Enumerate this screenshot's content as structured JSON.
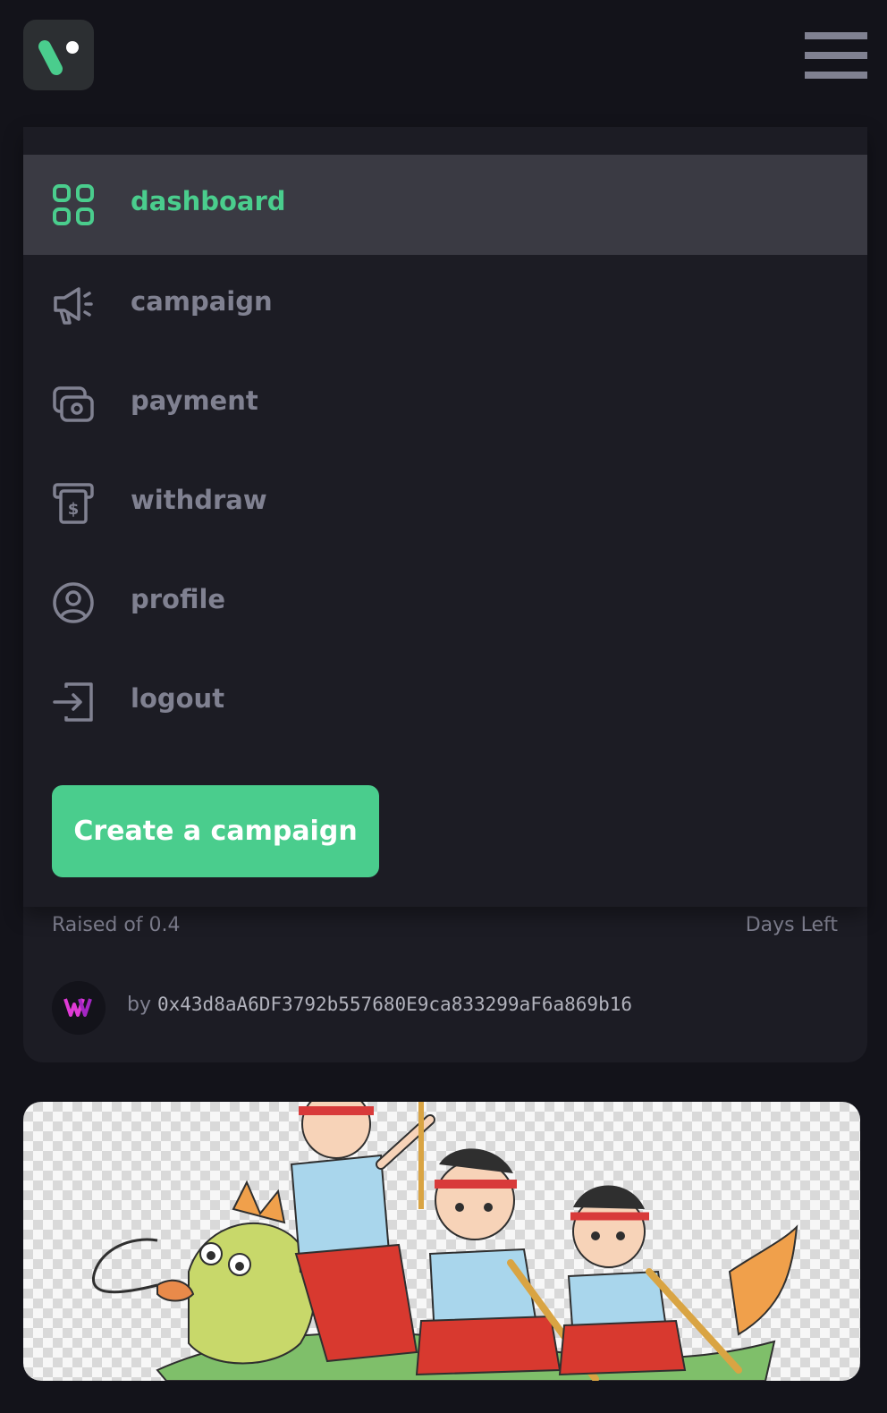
{
  "header": {
    "logo_icon": "brand-logo-icon",
    "menu_icon": "hamburger-menu-icon"
  },
  "menu": {
    "items": [
      {
        "label": "dashboard",
        "icon": "dashboard-grid-icon",
        "active": true
      },
      {
        "label": "campaign",
        "icon": "megaphone-icon",
        "active": false
      },
      {
        "label": "payment",
        "icon": "money-icon",
        "active": false
      },
      {
        "label": "withdraw",
        "icon": "withdraw-dollar-icon",
        "active": false
      },
      {
        "label": "profile",
        "icon": "user-circle-icon",
        "active": false
      },
      {
        "label": "logout",
        "icon": "logout-arrow-icon",
        "active": false
      }
    ],
    "cta_label": "Create a campaign"
  },
  "campaign_card": {
    "raised_text": "Raised of 0.4",
    "days_left_text": "Days Left",
    "by_prefix": "by",
    "owner_address": "0x43d8aA6DF3792b557680E9ca833299aF6a869b16"
  },
  "colors": {
    "background": "#13131a",
    "surface": "#1c1c24",
    "active_surface": "#3a3a43",
    "accent": "#4acd8d",
    "muted_text": "#808191"
  },
  "image_card": {
    "image": "dragon-boat-illustration"
  }
}
